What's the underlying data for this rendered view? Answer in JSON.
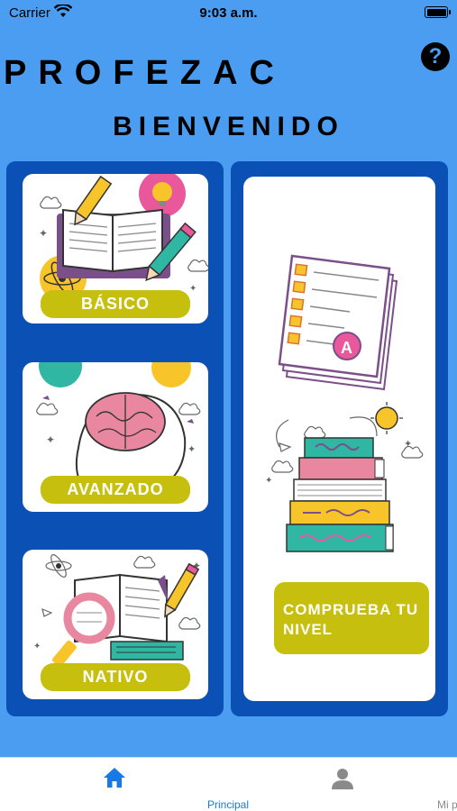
{
  "status_bar": {
    "carrier": "Carrier",
    "time": "9:03 a.m."
  },
  "header": {
    "app_title": "PROFEZAC",
    "welcome": "BIENVENIDO"
  },
  "levels": [
    {
      "label": "BÁSICO"
    },
    {
      "label": "AVANZADO"
    },
    {
      "label": "NATIVO"
    }
  ],
  "test_card": {
    "button_label": "COMPRUEBA TU NIVEL"
  },
  "tab_bar": {
    "tabs": [
      {
        "label": "Principal",
        "icon": "home-icon",
        "active": true
      },
      {
        "label": "Mi perfil",
        "icon": "person-icon",
        "active": false
      }
    ]
  },
  "colors": {
    "background": "#4a9df0",
    "panel": "#0a50b5",
    "accent_button": "#c7bf0e",
    "active_tab": "#1779e6"
  }
}
